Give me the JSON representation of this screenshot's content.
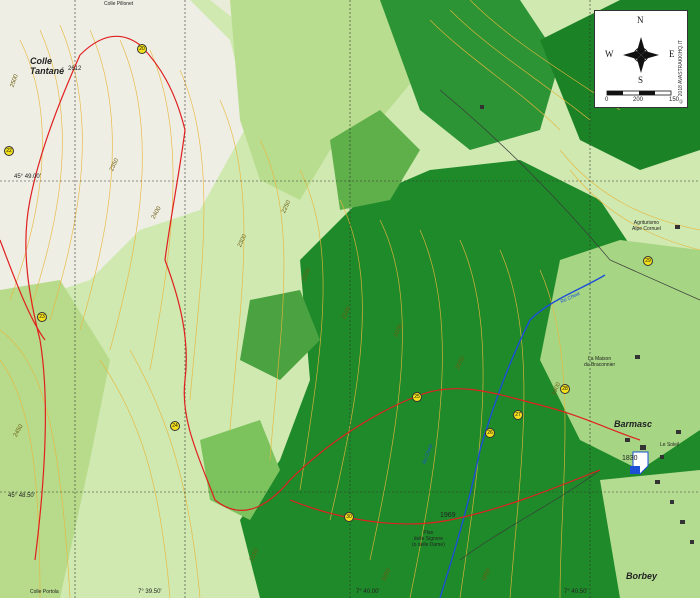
{
  "places": {
    "colle_tantane": "Colle\nTantané",
    "colle_tantane_alt": "2612",
    "barmasc": "Barmasc",
    "barmasc_alt": "1830",
    "borbey": "Borbey",
    "piano": "Plan\ndelle Signore\n(o delle Dame)",
    "piano_alt": "1969",
    "agriturismo": "Agriturismo\nAlpe Cornuel",
    "maison": "La Maison\ndu Braconnier",
    "soleil": "Le Soleil",
    "top_road": "Colle Pillonet",
    "bottom_road": "Colle Portola"
  },
  "coords": {
    "lat_1": "45° 49.00'",
    "lat_2": "45° 48.50'",
    "lon_1": "7° 39.50'",
    "lon_2": "7° 40.00'",
    "lon_3": "7° 40.50'"
  },
  "contours": [
    "2500",
    "2400",
    "2300",
    "2200",
    "2100",
    "2000",
    "1900",
    "2450",
    "2350",
    "2250",
    "2150",
    "2050",
    "1950",
    "1850"
  ],
  "stream": "Rü Cheia",
  "markers": [
    "20",
    "22",
    "23",
    "24",
    "25",
    "26",
    "27",
    "28",
    "29",
    "30"
  ],
  "compass": {
    "n": "N",
    "s": "S",
    "e": "E",
    "w": "W"
  },
  "scale": {
    "zero": "0",
    "mid": "200",
    "end": "150"
  },
  "copyright": "© 2018 AVASTRAKKIHQ.IT",
  "colors": {
    "forest": "#1f8a2a",
    "meadow": "#9fd07a",
    "rock": "#efefe6",
    "contour": "#e9b63c",
    "trail": "#e02020"
  }
}
